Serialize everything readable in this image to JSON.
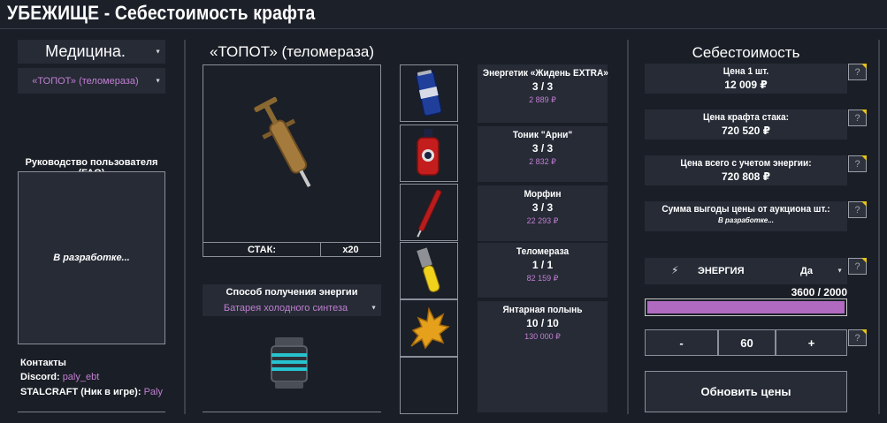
{
  "app": {
    "title": "УБЕЖИЩЕ - Себестоимость крафта"
  },
  "sidebar": {
    "category": "Медицина.",
    "item_select": "«ТОПОТ» (теломераза)",
    "faq_title": "Руководство пользователя (FAQ)",
    "faq_body": "В разработке...",
    "contacts": {
      "title": "Контакты",
      "discord_label": "Discord:",
      "discord_value": "paly_ebt",
      "stalcraft_label": "STALCRAFT (Ник в игре):",
      "stalcraft_value": "Paly"
    }
  },
  "craft": {
    "item_title": "«ТОПОТ» (теломераза)",
    "stack_label": "СТАК:",
    "stack_value": "x20",
    "energy_source_label": "Способ получения энергии",
    "energy_source_value": "Батарея холодного синтеза"
  },
  "ingredients": [
    {
      "name": "Энергетик «Жидень EXTRA»",
      "qty": "3 / 3",
      "price": "2 889 ₽"
    },
    {
      "name": "Тоник \"Арни\"",
      "qty": "3 / 3",
      "price": "2 832 ₽"
    },
    {
      "name": "Морфин",
      "qty": "3 / 3",
      "price": "22 293 ₽"
    },
    {
      "name": "Теломераза",
      "qty": "1 / 1",
      "price": "82 159 ₽"
    },
    {
      "name": "Янтарная полынь",
      "qty": "10 / 10",
      "price": "130 000 ₽"
    }
  ],
  "cost": {
    "title": "Себестоимость",
    "rows": [
      {
        "label": "Цена 1 шт.",
        "value": "12 009 ₽"
      },
      {
        "label": "Цена крафта стака:",
        "value": "720 520 ₽"
      },
      {
        "label": "Цена всего с учетом энергии:",
        "value": "720 808 ₽"
      },
      {
        "label": "Сумма выгоды цены от аукциона шт.:",
        "value": "В разработке..."
      }
    ],
    "help_label": "?",
    "energy_label": "ЭНЕРГИЯ",
    "energy_option": "Да",
    "energy_value": "3600 / 2000",
    "energy_fill_fraction": 1.0,
    "stepper_minus": "-",
    "stepper_value": "60",
    "stepper_plus": "+",
    "update_button": "Обновить цены"
  },
  "colors": {
    "accent": "#c27fd3",
    "panel": "#262b36",
    "background": "#1a1e26",
    "help_corner": "#e6c21b"
  }
}
